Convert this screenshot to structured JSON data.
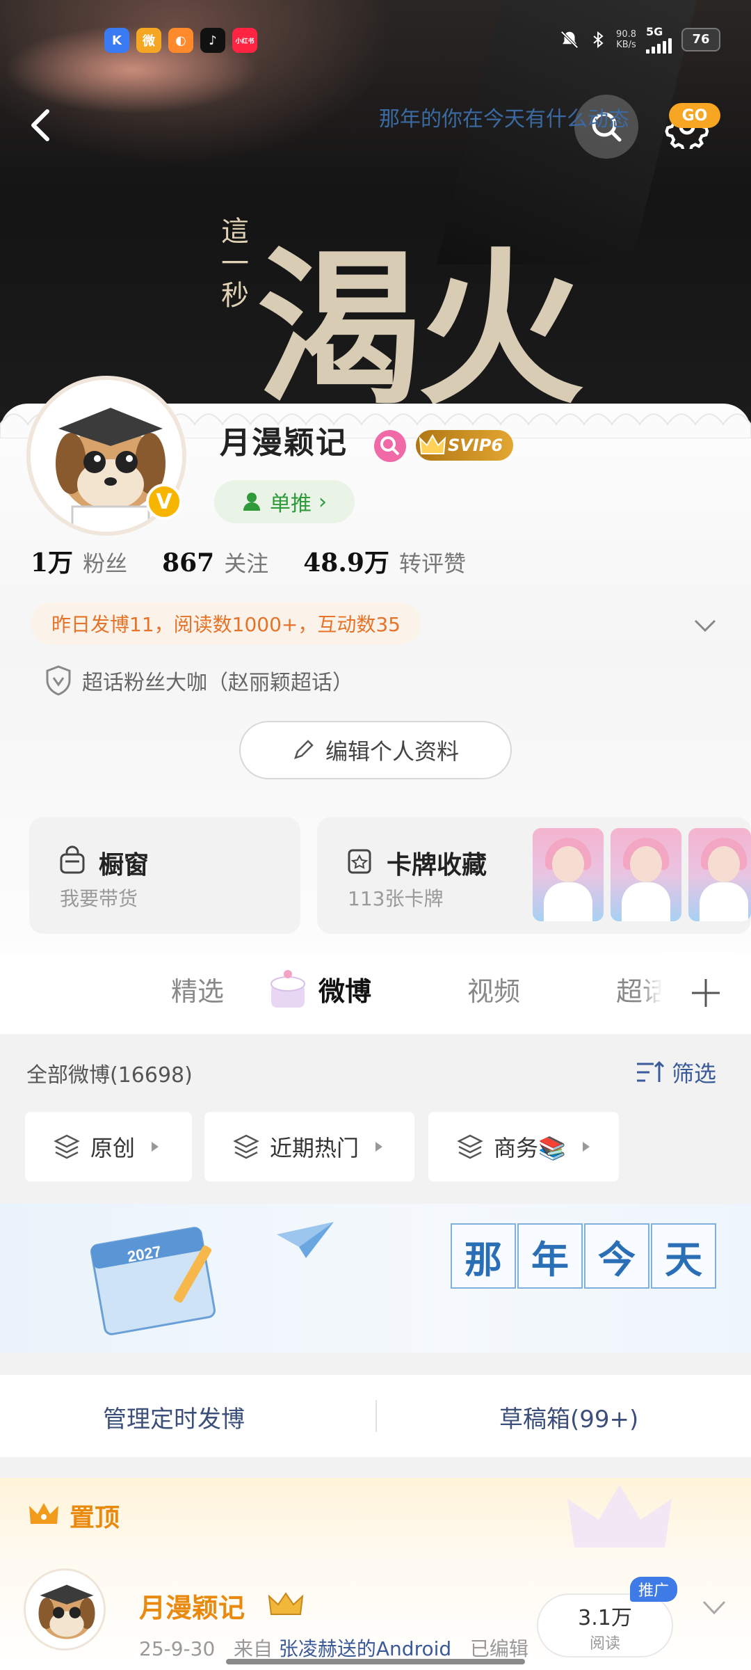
{
  "status_bar": {
    "apps": [
      {
        "icon": "kuaishou-k-icon",
        "color": "#3a7af2",
        "glyph": "K"
      },
      {
        "icon": "weibo-icon",
        "color": "#f5a623",
        "glyph": "微"
      },
      {
        "icon": "bilibili-icon",
        "color": "#ff8a2c",
        "glyph": "◐"
      },
      {
        "icon": "tiktok-icon",
        "color": "#111111",
        "glyph": "♪"
      },
      {
        "icon": "xiaohongshu-icon",
        "color": "#ff2442",
        "glyph": "小红书"
      }
    ],
    "net_speed_value": "90.8",
    "net_speed_unit": "KB/s",
    "network": "5G",
    "battery": "76"
  },
  "banner": {
    "poster_title": "渴火",
    "poster_sub": "這一秒"
  },
  "profile": {
    "username": "月漫颖记",
    "svip_label": "SVIP6",
    "recommend_label": "单推",
    "stats": [
      {
        "value": "1万",
        "label": "粉丝"
      },
      {
        "value": "867",
        "label": "关注"
      },
      {
        "value": "48.9万",
        "label": "转评赞"
      }
    ],
    "yesterday_summary": "昨日发博11，阅读数1000+，互动数35",
    "superfan": "超话粉丝大咖（赵丽颖超话）",
    "edit_profile": "编辑个人资料"
  },
  "tiles": {
    "shop_title": "橱窗",
    "shop_sub": "我要带货",
    "cards_title": "卡牌收藏",
    "cards_sub": "113张卡牌"
  },
  "tabs": [
    {
      "label": "精选",
      "active": false
    },
    {
      "label": "微博",
      "active": true
    },
    {
      "label": "视频",
      "active": false
    },
    {
      "label": "超话",
      "active": false
    }
  ],
  "feed": {
    "count_label": "全部微博(16698)",
    "filter_label": "筛选",
    "chips": [
      "原创",
      "近期热门",
      "商务📚"
    ]
  },
  "memory": {
    "year_tag": "2027",
    "chars": [
      "那",
      "年",
      "今",
      "天"
    ],
    "subtitle": "那年的你在今天有什么动态",
    "go": "GO"
  },
  "manage": {
    "scheduled": "管理定时发博",
    "drafts": "草稿箱(99+)"
  },
  "pinned": {
    "label": "置顶",
    "author": "月漫颖记",
    "date": "25-9-30",
    "from_prefix": "来自",
    "device": "张凌赫送的Android",
    "edited": "已编辑",
    "reads_value": "3.1万",
    "reads_label": "阅读",
    "promo": "推广"
  },
  "colors": {
    "accent_orange": "#e98a0f",
    "link_blue": "#3b5a9a",
    "verify_gold": "#f7b500"
  }
}
